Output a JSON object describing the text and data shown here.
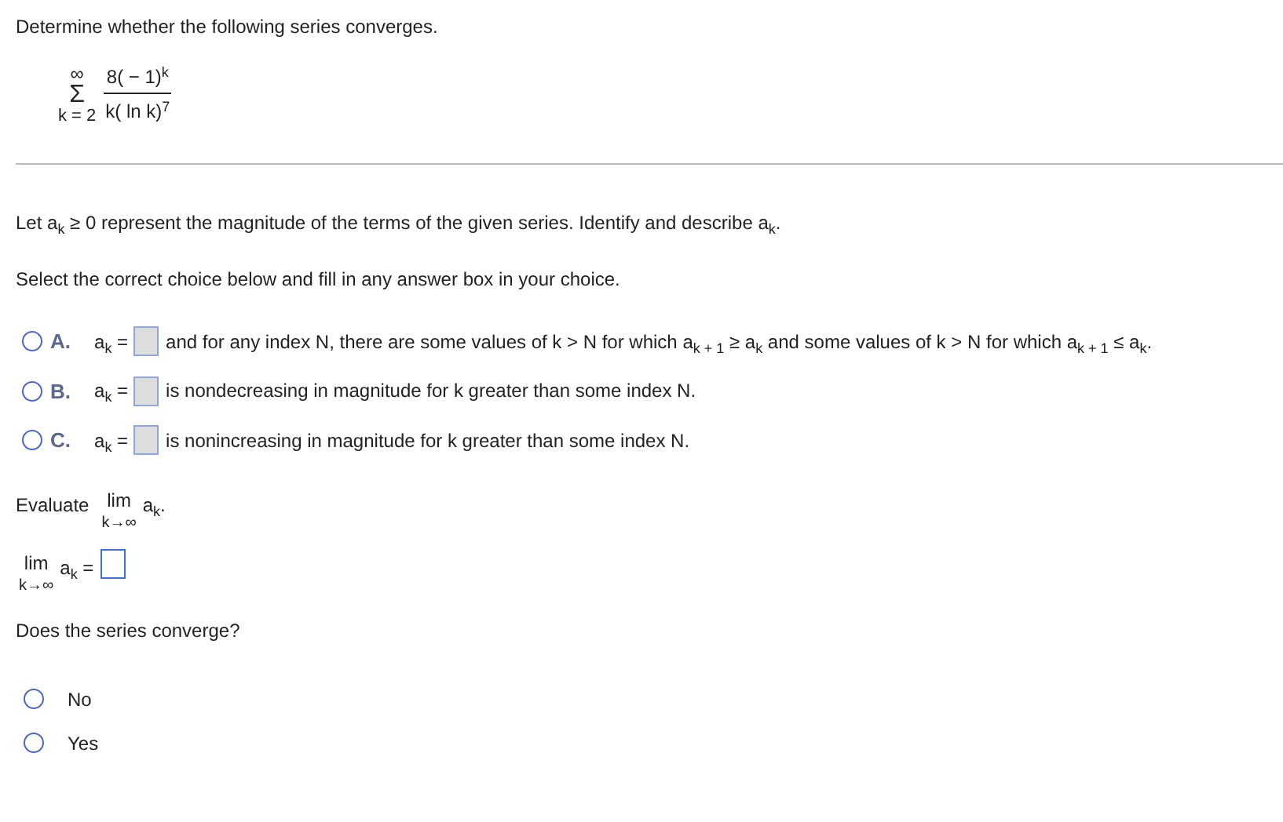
{
  "prompt": "Determine whether the following series converges.",
  "series": {
    "upper": "∞",
    "sigma": "Σ",
    "lower": "k = 2",
    "numerator": "8( − 1)$^{k}$",
    "denominator": "k( ln k)$^{7}$"
  },
  "intro": "Let a$_{k}$ ≥ 0 represent the magnitude of the terms of the given series. Identify and describe a$_{k}$.",
  "instruction": "Select the correct choice below and fill in any answer box in your choice.",
  "choices": [
    {
      "letter": "A.",
      "lhs": "a$_{k}$ =",
      "box_enabled": false,
      "text": "and for any index N, there are some values of k > N for which a$_{k + 1}$ ≥ a$_{k}$ and some values of k > N for which a$_{k + 1}$ ≤ a$_{k}$.",
      "selected": false
    },
    {
      "letter": "B.",
      "lhs": "a$_{k}$ =",
      "box_enabled": false,
      "text": "is nondecreasing in magnitude for k greater than some index N.",
      "selected": false
    },
    {
      "letter": "C.",
      "lhs": "a$_{k}$ =",
      "box_enabled": false,
      "text": "is nonincreasing in magnitude for k greater than some index N.",
      "selected": false
    }
  ],
  "evaluate": {
    "label": "Evaluate",
    "lim": "lim",
    "under": "k→∞",
    "expr": "a$_{k}$."
  },
  "limit_answer": {
    "lim": "lim",
    "under": "k→∞",
    "expr": "a$_{k}$ =",
    "box_enabled": true
  },
  "question": "Does the series converge?",
  "options": [
    {
      "label": "No",
      "selected": false
    },
    {
      "label": "Yes",
      "selected": false
    }
  ]
}
